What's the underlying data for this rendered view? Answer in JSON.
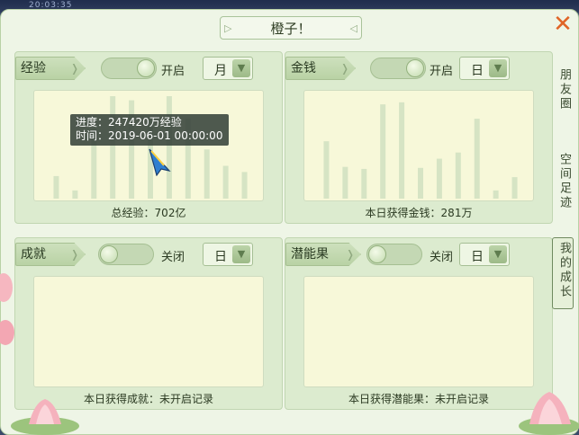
{
  "topstrip": {
    "text": "20:03:35"
  },
  "window": {
    "title": "橙子！"
  },
  "panels": [
    {
      "tag": "经验",
      "toggle": "开启",
      "toggle_state": "on",
      "period": "月",
      "summary": "总经验：702亿",
      "chart_data": {
        "type": "bar",
        "values": [
          22,
          8,
          68,
          100,
          96,
          78,
          100,
          78,
          48,
          32,
          26
        ],
        "ylim": [
          0,
          100
        ]
      }
    },
    {
      "tag": "金钱",
      "toggle": "开启",
      "toggle_state": "on",
      "period": "日",
      "summary": "本日获得金钱：281万",
      "chart_data": {
        "type": "bar",
        "values": [
          56,
          31,
          29,
          92,
          94,
          30,
          39,
          45,
          78,
          8,
          21
        ],
        "ylim": [
          0,
          100
        ]
      }
    },
    {
      "tag": "成就",
      "toggle": "关闭",
      "toggle_state": "off",
      "period": "日",
      "summary": "本日获得成就：未开启记录"
    },
    {
      "tag": "潜能果",
      "toggle": "关闭",
      "toggle_state": "off",
      "period": "日",
      "summary": "本日获得潜能果：未开启记录"
    }
  ],
  "tooltip": {
    "line1": "进度：247420万经验",
    "line2": "时间：2019-06-01 00:00:00"
  },
  "side_tabs": [
    {
      "label": "朋友圈",
      "active": false
    },
    {
      "label": "空间足迹",
      "active": false
    },
    {
      "label": "我的成长",
      "active": true
    }
  ],
  "colors": {
    "bar": "#d6e4c4",
    "accent": "#e06426"
  }
}
